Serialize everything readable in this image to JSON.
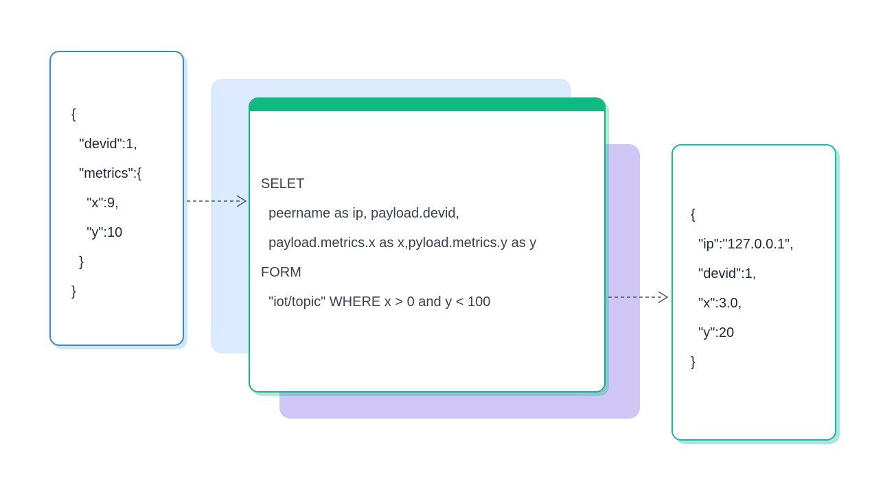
{
  "input": {
    "json": "{\n  ''devid\":1,\n  \"metrics\":{\n    \"x\":9,\n    \"y\":10\n  }\n}"
  },
  "sql": {
    "text": "SELET\n  peername as ip, payload.devid,\n  payload.metrics.x as x,pyload.metrics.y as y\nFORM\n  \"iot/topic\" WHERE x > 0 and y < 100"
  },
  "output": {
    "json": "{\n  \"ip\":\"127.0.0.1\",\n  \"devid\":1,\n  \"x\":3.0,\n  \"y\":20\n}"
  },
  "colors": {
    "inputBorder": "#3b82f6",
    "sqlBorder": "#10b981",
    "outputBorder": "#14b8a6",
    "bgBlue": "#dbeafe",
    "bgPurple": "#cfc6f5"
  }
}
